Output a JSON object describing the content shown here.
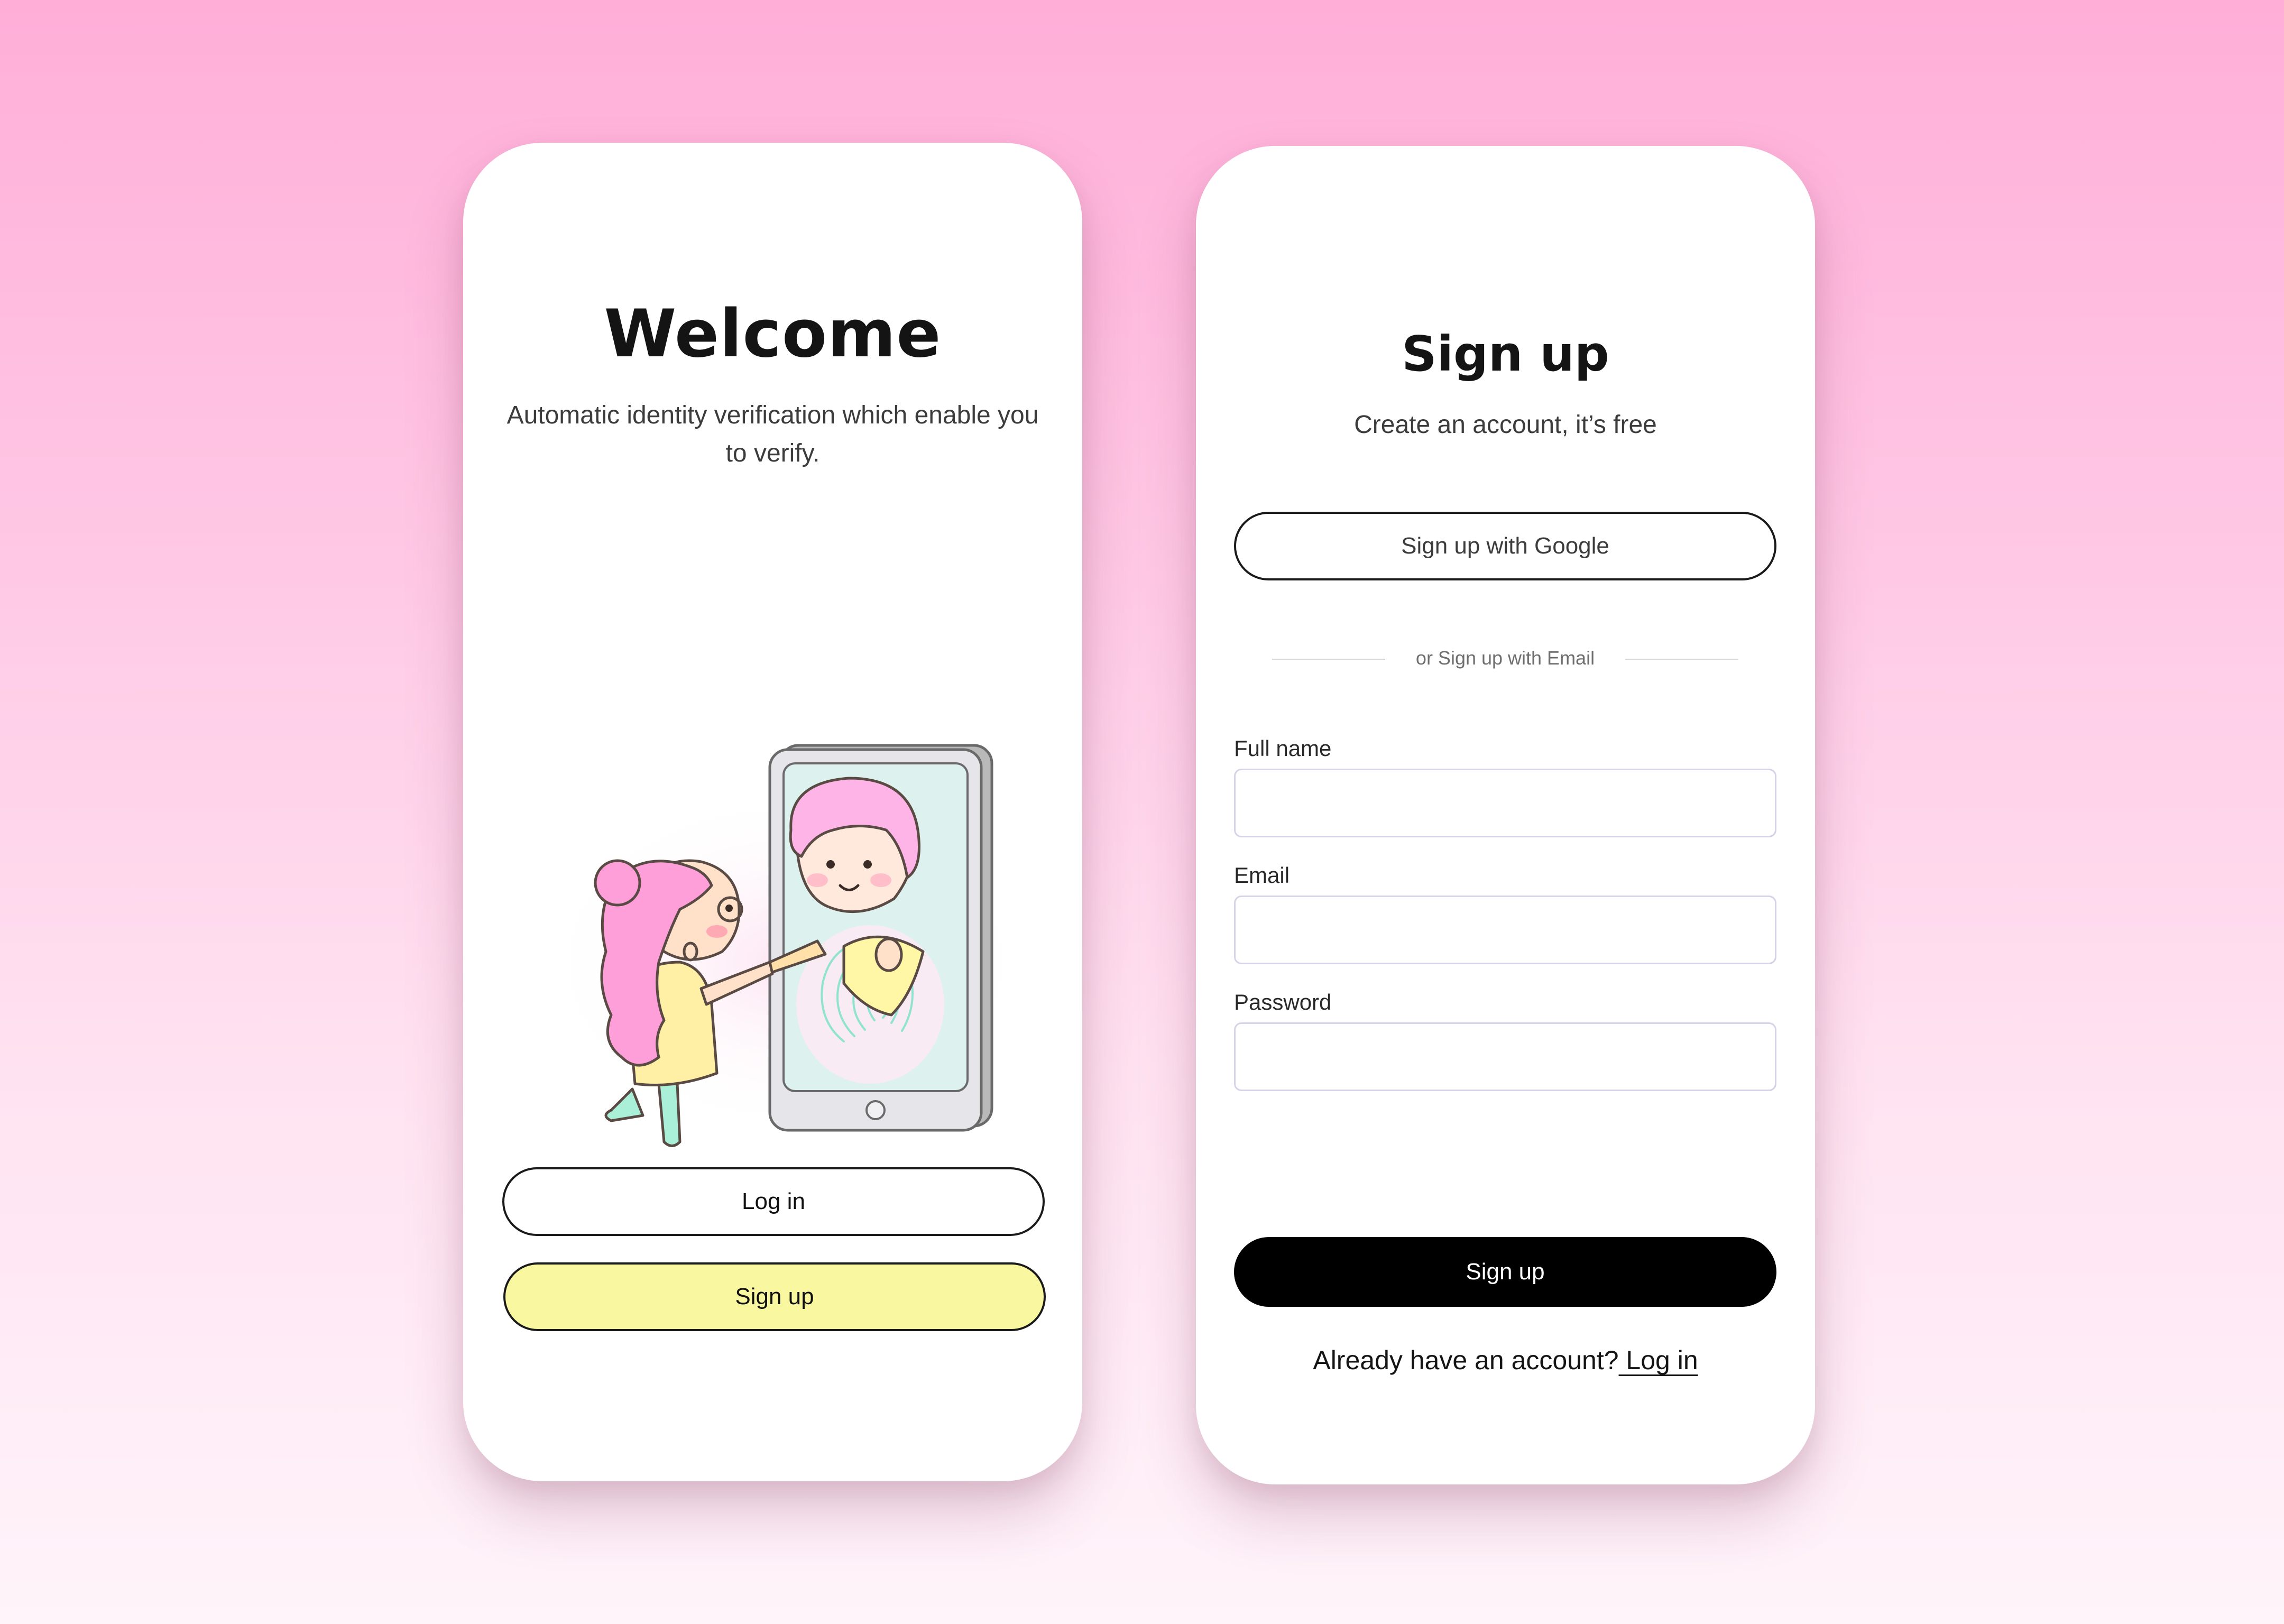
{
  "welcome": {
    "title": "Welcome",
    "subtitle": "Automatic identity verification which enable you to verify.",
    "login_label": "Log in",
    "signup_label": "Sign up"
  },
  "signup": {
    "title": "Sign up",
    "subtitle": "Create an account, it’s free",
    "google_label": "Sign up with Google",
    "divider_text": "or Sign up with Email",
    "fields": [
      {
        "label": "Full name",
        "value": "",
        "placeholder": ""
      },
      {
        "label": "Email",
        "value": "",
        "placeholder": ""
      },
      {
        "label": "Password",
        "value": "",
        "placeholder": ""
      }
    ],
    "submit_label": "Sign up",
    "footer_text": "Already have an account?",
    "footer_link": " Log in"
  },
  "icons": {
    "illustration": "identity-verification-illustration"
  },
  "colors": {
    "background_top": "#ffaed8",
    "background_bottom": "#fff4fa",
    "signup_button_yellow": "#faf7a1",
    "primary_button_black": "#000000",
    "input_border": "#d5d4e6"
  }
}
